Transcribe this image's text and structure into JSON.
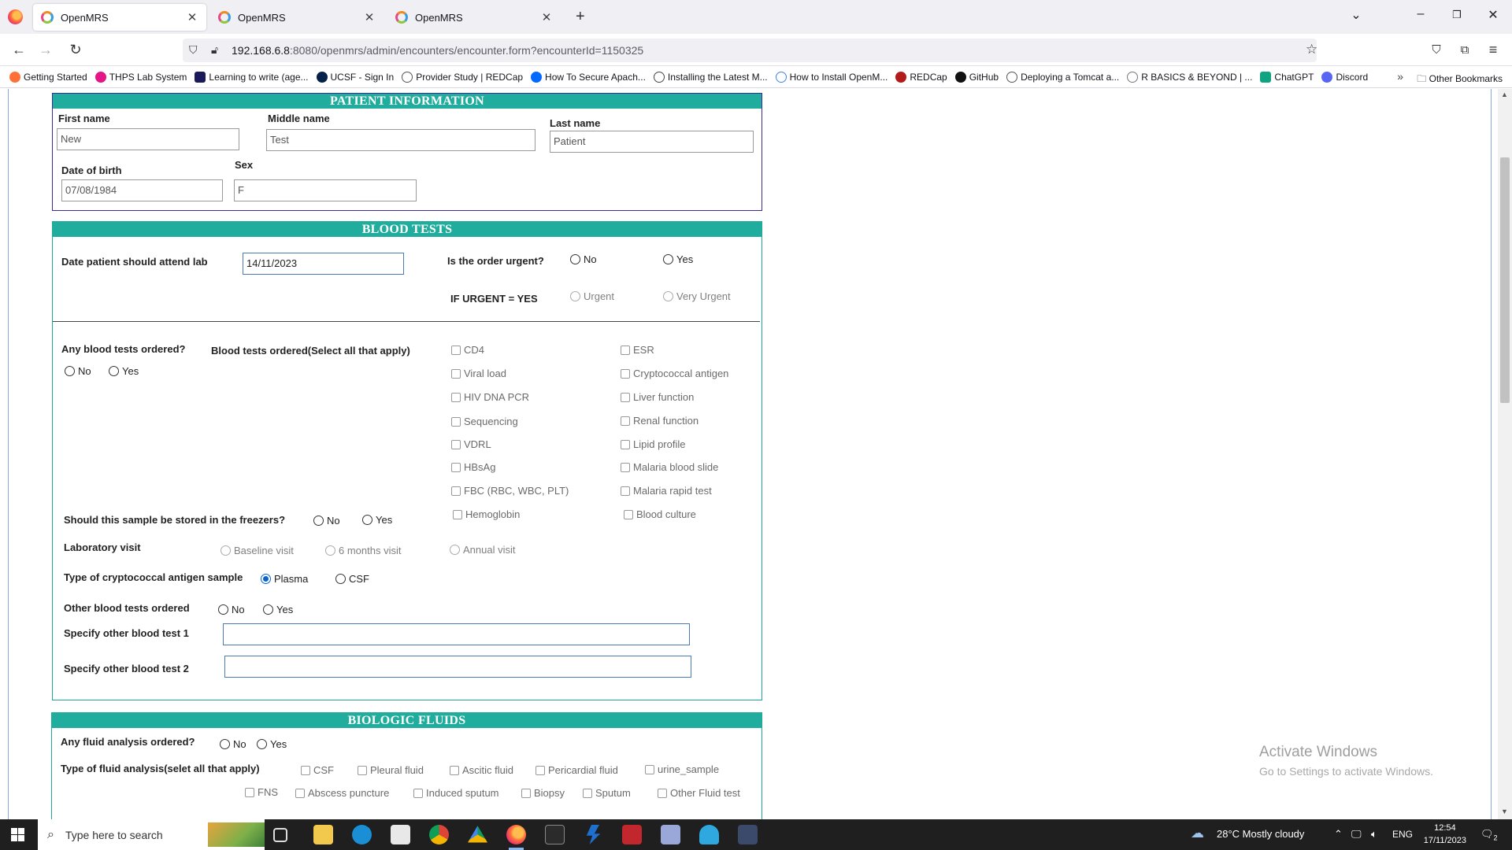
{
  "browser": {
    "tabs": [
      {
        "label": "OpenMRS",
        "active": true
      },
      {
        "label": "OpenMRS",
        "active": false
      },
      {
        "label": "OpenMRS",
        "active": false
      }
    ],
    "url_host": "192.168.6.8",
    "url_rest": ":8080/openmrs/admin/encounters/encounter.form?encounterId=1150325",
    "bookmarks": [
      {
        "label": "Getting Started",
        "color": "#ff7139"
      },
      {
        "label": "THPS Lab System",
        "color": "#e31587"
      },
      {
        "label": "Learning to write (age...",
        "color": "#1a1a5a"
      },
      {
        "label": "UCSF - Sign In",
        "color": "#052049"
      },
      {
        "label": "Provider Study | REDCap",
        "color": "#555555"
      },
      {
        "label": "How To Secure Apach...",
        "color": "#0069ff"
      },
      {
        "label": "Installing the Latest M...",
        "color": "#444444"
      },
      {
        "label": "How to Install OpenM...",
        "color": "#3b82f6"
      },
      {
        "label": "REDCap",
        "color": "#b31b1b"
      },
      {
        "label": "GitHub",
        "color": "#111111"
      },
      {
        "label": "Deploying a Tomcat a...",
        "color": "#555555"
      },
      {
        "label": "R BASICS & BEYOND | ...",
        "color": "#777777"
      },
      {
        "label": "ChatGPT",
        "color": "#10a37f"
      },
      {
        "label": "Discord",
        "color": "#5865f2"
      }
    ],
    "other_bookmarks": "Other Bookmarks"
  },
  "patient": {
    "heading": "PATIENT INFORMATION",
    "first_name_label": "First name",
    "first_name": "New",
    "middle_name_label": "Middle name",
    "middle_name": "Test",
    "last_name_label": "Last name",
    "last_name": "Patient",
    "dob_label": "Date of birth",
    "dob": "07/08/1984",
    "sex_label": "Sex",
    "sex": "F"
  },
  "blood": {
    "heading": "BLOOD TESTS",
    "attend_label": "Date patient should attend lab",
    "attend_date": "14/11/2023",
    "urgent_label": "Is the order urgent?",
    "no": "No",
    "yes": "Yes",
    "if_urgent_label": "IF URGENT = YES",
    "urgent": "Urgent",
    "very_urgent": "Very Urgent",
    "any_label": "Any blood tests ordered?",
    "ordered_label": "Blood tests ordered(Select all that apply)",
    "tests_left": [
      "CD4",
      "Viral load",
      "HIV DNA PCR",
      "Sequencing",
      "VDRL",
      "HBsAg",
      "FBC (RBC, WBC, PLT)",
      "Hemoglobin"
    ],
    "tests_right": [
      "ESR",
      "Cryptococcal antigen",
      "Liver function",
      "Renal function",
      "Lipid profile",
      "Malaria blood slide",
      "Malaria rapid test",
      "Blood culture"
    ],
    "freezer_label": "Should this sample be stored in the freezers?",
    "visit_label": "Laboratory visit",
    "visit_baseline": "Baseline visit",
    "visit_6m": "6 months visit",
    "visit_annual": "Annual visit",
    "crypto_label": "Type of cryptococcal antigen sample",
    "crypto_plasma": "Plasma",
    "crypto_csf": "CSF",
    "other_label": "Other blood tests ordered",
    "spec1_label": "Specify other blood test 1",
    "spec2_label": "Specify other blood test 2"
  },
  "fluids": {
    "heading": "BIOLOGIC FLUIDS",
    "any_label": "Any fluid analysis ordered?",
    "no": "No",
    "yes": "Yes",
    "type_label": "Type of fluid analysis(selet all that apply)",
    "row1": [
      "CSF",
      "Pleural fluid",
      "Ascitic fluid",
      "Pericardial fluid",
      "urine_sample"
    ],
    "row2": [
      "FNS",
      "Abscess puncture",
      "Induced sputum",
      "Biopsy",
      "Sputum",
      "Other Fluid test"
    ]
  },
  "watermark": {
    "line1": "Activate Windows",
    "line2": "Go to Settings to activate Windows."
  },
  "taskbar": {
    "search_placeholder": "Type here to search",
    "weather": "28°C  Mostly cloudy",
    "lang": "ENG",
    "time": "12:54",
    "date": "17/11/2023",
    "notifications": "2"
  }
}
